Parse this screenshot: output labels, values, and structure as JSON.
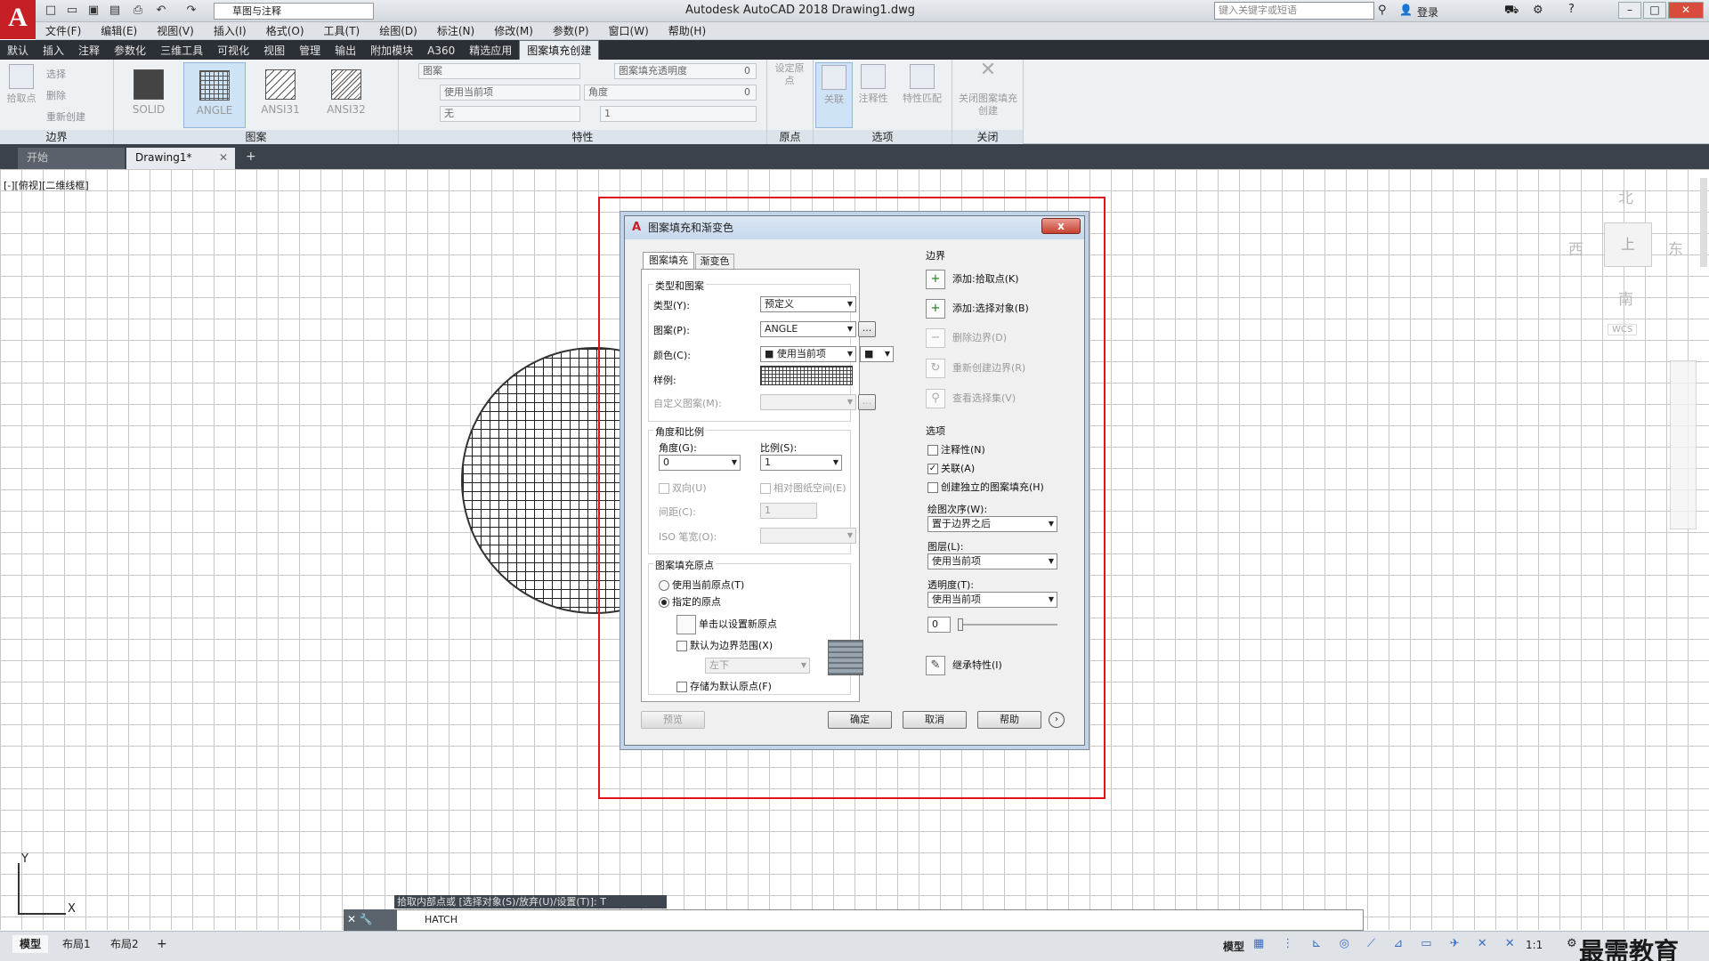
{
  "app": {
    "title": "Autodesk AutoCAD 2018    Drawing1.dwg",
    "workspace": "草图与注释",
    "search_placeholder": "键入关键字或短语",
    "login": "登录"
  },
  "menu": [
    "文件(F)",
    "编辑(E)",
    "视图(V)",
    "插入(I)",
    "格式(O)",
    "工具(T)",
    "绘图(D)",
    "标注(N)",
    "修改(M)",
    "参数(P)",
    "窗口(W)",
    "帮助(H)"
  ],
  "ribbon_tabs": [
    "默认",
    "插入",
    "注释",
    "参数化",
    "三维工具",
    "可视化",
    "视图",
    "管理",
    "输出",
    "附加模块",
    "A360",
    "精选应用",
    "图案填充创建"
  ],
  "ribbon": {
    "boundary": {
      "title": "边界",
      "pick": "拾取点",
      "select": "选择",
      "remove": "删除",
      "recreate": "重新创建"
    },
    "pattern": {
      "title": "图案",
      "items": [
        "SOLID",
        "ANGLE",
        "ANSI31",
        "ANSI32"
      ]
    },
    "properties": {
      "title": "特性",
      "type": "图案",
      "use_current": "使用当前项",
      "none": "无",
      "transparency_label": "图案填充透明度",
      "transparency": "0",
      "angle_label": "角度",
      "angle": "0",
      "scale": "1"
    },
    "origin": {
      "title": "原点",
      "set": "设定原点"
    },
    "options": {
      "title": "选项",
      "assoc": "关联",
      "annot": "注释性",
      "match": "特性匹配"
    },
    "close": {
      "title": "关闭",
      "label": "关闭图案填充创建"
    }
  },
  "doc_tabs": [
    "开始",
    "Drawing1*"
  ],
  "viewport_label": "[-][俯视][二维线框]",
  "compass": {
    "n": "北",
    "s": "南",
    "e": "东",
    "w": "西",
    "center": "上",
    "wcs": "WCS"
  },
  "dialog": {
    "title": "图案填充和渐变色",
    "close": "x",
    "tabs": [
      "图案填充",
      "渐变色"
    ],
    "type_pattern": {
      "header": "类型和图案",
      "type_label": "类型(Y):",
      "type_value": "预定义",
      "pattern_label": "图案(P):",
      "pattern_value": "ANGLE",
      "color_label": "颜色(C):",
      "color_value": "■ 使用当前项",
      "swatch_label": "样例:",
      "custom_label": "自定义图案(M):"
    },
    "angle_scale": {
      "header": "角度和比例",
      "angle_label": "角度(G):",
      "angle_value": "0",
      "scale_label": "比例(S):",
      "scale_value": "1",
      "double": "双向(U)",
      "relative": "相对图纸空间(E)",
      "spacing_label": "间距(C):",
      "spacing_value": "1",
      "iso_label": "ISO 笔宽(O):"
    },
    "origin": {
      "header": "图案填充原点",
      "use_current": "使用当前原点(T)",
      "specified": "指定的原点",
      "click_set": "单击以设置新原点",
      "default_boundary": "默认为边界范围(X)",
      "position": "左下",
      "store_default": "存储为默认原点(F)"
    },
    "boundaries": {
      "header": "边界",
      "add_pick": "添加:拾取点(K)",
      "add_select": "添加:选择对象(B)",
      "remove": "删除边界(D)",
      "recreate": "重新创建边界(R)",
      "view": "查看选择集(V)"
    },
    "options": {
      "header": "选项",
      "annotative": "注释性(N)",
      "associative": "关联(A)",
      "separate": "创建独立的图案填充(H)",
      "draw_order_label": "绘图次序(W):",
      "draw_order_value": "置于边界之后",
      "layer_label": "图层(L):",
      "layer_value": "使用当前项",
      "transparency_label": "透明度(T):",
      "transparency_value": "使用当前项",
      "transparency_num": "0"
    },
    "inherit": "继承特性(I)",
    "buttons": {
      "preview": "预览",
      "ok": "确定",
      "cancel": "取消",
      "help": "帮助"
    }
  },
  "command": {
    "prompt": "拾取内部点或 [选择对象(S)/放弃(U)/设置(T)]: T",
    "text": "HATCH"
  },
  "status": {
    "layout_tabs": [
      "模型",
      "布局1",
      "布局2"
    ],
    "model": "模型",
    "scale": "1:1",
    "watermark": "最需教育"
  }
}
